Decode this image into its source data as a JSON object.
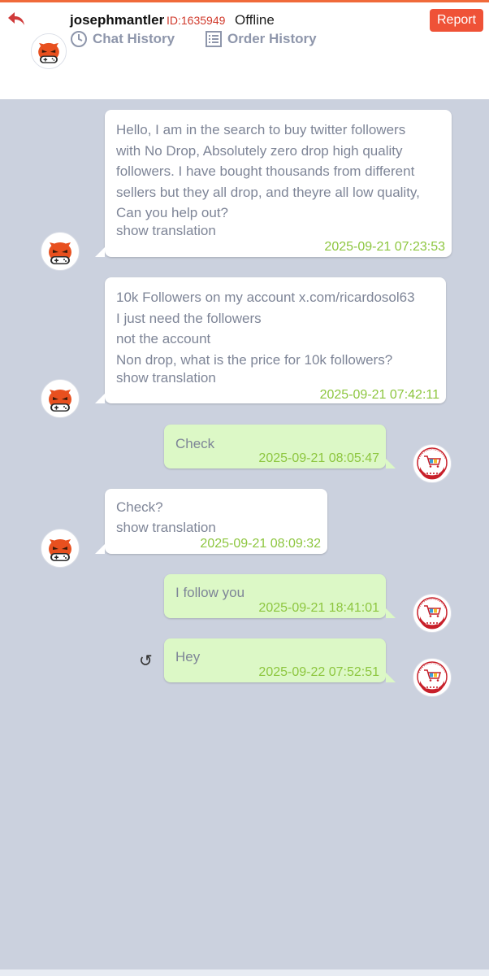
{
  "header": {
    "username": "josephmantler",
    "user_id": "ID:1635949",
    "status": "Offline",
    "report_label": "Report",
    "chat_history_label": "Chat History",
    "order_history_label": "Order History"
  },
  "messages": [
    {
      "side": "in",
      "text": "Hello, I am in the search to buy twitter followers\nwith No Drop, Absolutely zero drop high quality\nfollowers. I have bought thousands from different\nsellers but they all drop, and theyre all low quality,\nCan you help out?",
      "translate_label": "show translation",
      "timestamp": "2025-09-21 07:23:53"
    },
    {
      "side": "in",
      "text": "10k Followers on my account x.com/ricardosol63\nI just need the followers\nnot the account\nNon drop, what is the price for 10k followers?",
      "translate_label": "show translation",
      "timestamp": "2025-09-21 07:42:11"
    },
    {
      "side": "out",
      "text": "Check",
      "timestamp": "2025-09-21 08:05:47"
    },
    {
      "side": "in",
      "text": "Check?",
      "translate_label": "show translation",
      "timestamp": "2025-09-21 08:09:32"
    },
    {
      "side": "out",
      "text": "I follow you",
      "timestamp": "2025-09-21 18:41:01"
    },
    {
      "side": "out",
      "text": "Hey",
      "timestamp": "2025-09-22 07:52:51"
    }
  ],
  "icons": {
    "back": "back-arrow-icon",
    "chat_history": "clock-icon",
    "order_history": "list-icon",
    "retry": "retry-icon",
    "avatar_in": "devil-gamepad-avatar",
    "avatar_out": "market-cart-avatar"
  },
  "retry_glyph": "↺",
  "colors": {
    "accent": "#ef5237",
    "user_id": "#d0392b",
    "chat_bg": "#cbd1de",
    "bubble_in": "#ffffff",
    "bubble_out": "#dcf8c6",
    "timestamp": "#8dc63f",
    "muted_text": "#7e8597"
  }
}
